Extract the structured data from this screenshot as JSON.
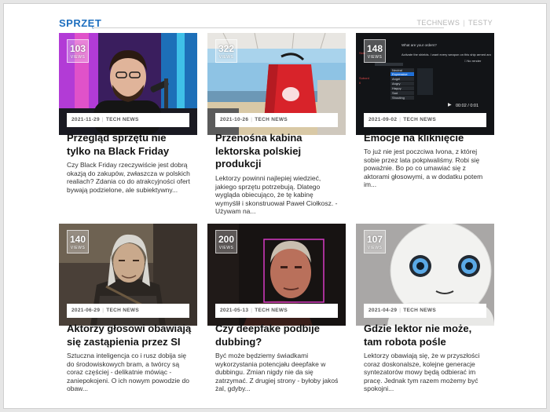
{
  "section": {
    "title": "SPRZĘT",
    "links": [
      "TECHNEWS",
      "TESTY"
    ]
  },
  "cards": [
    {
      "views": "103",
      "views_label": "VIEWS",
      "date": "2021-11-29",
      "category": "TECH NEWS",
      "title": "Przegląd sprzętu nie tylko na Black Friday",
      "excerpt": "Czy Black Friday rzeczywiście jest dobrą okazją do zakupów, zwłaszcza w polskich realiach? Zdania co do atrakcyjności ofert bywają podzielone, ale subiektywny..."
    },
    {
      "views": "322",
      "views_label": "VIEWS",
      "date": "2021-10-26",
      "category": "TECH NEWS",
      "title": "Przenośna kabina lektorska polskiej produkcji",
      "excerpt": "Lektorzy powinni najlepiej wiedzieć, jakiego sprzętu potrzebują. Dlatego wygląda obiecująco, że tę kabinę wymyślił i skonstruował Paweł Ciołkosz. - Używam na..."
    },
    {
      "views": "148",
      "views_label": "VIEWS",
      "date": "2021-09-02",
      "category": "TECH NEWS",
      "title": "Emocje na kliknięcie",
      "excerpt": "To już nie jest poczciwa Ivona, z której sobie przez lata pokpiwaliśmy. Robi się poważnie. Bo po co umawiać się z aktorami głosowymi, a w dodatku potem im...",
      "screen": {
        "question": "What are your orders?",
        "instruction": "Activate the shields. I want every weapon on this ship armed and ready.",
        "side_label_1": "Side",
        "side_label_2": "Subord",
        "side_value": "0",
        "rows": [
          "Neutral",
          "Expressive",
          "Angel",
          "Angry",
          "Happy",
          "Sad",
          "Shouting"
        ],
        "time": "00:02 / 0:01",
        "checkbox_label": "No render"
      }
    },
    {
      "views": "140",
      "views_label": "VIEWS",
      "date": "2021-06-29",
      "category": "TECH NEWS",
      "title": "Aktorzy głosowi obawiają się zastąpienia przez SI",
      "excerpt": "Sztuczna inteligencja co i rusz dobija się do środowiskowych bram, a twórcy są coraz częściej - delikatnie mówiąc - zaniepokojeni. O ich nowym powodzie do obaw..."
    },
    {
      "views": "200",
      "views_label": "VIEWS",
      "date": "2021-05-13",
      "category": "TECH NEWS",
      "title": "Czy deepfake podbije dubbing?",
      "excerpt": "Być może będziemy świadkami wykorzystania potencjału deepfake w dubbingu. Zmian nigdy nie da się zatrzymać. Z drugiej strony - byłoby jakoś żal, gdyby..."
    },
    {
      "views": "107",
      "views_label": "VIEWS",
      "date": "2021-04-29",
      "category": "TECH NEWS",
      "title": "Gdzie lektor nie może, tam robota pośle",
      "excerpt": "Lektorzy obawiają się, że w przyszłości coraz doskonalsze, kolejne generacje syntezatorów mowy będą odbierać im pracę. Jednak tym razem możemy być spokojni..."
    }
  ]
}
